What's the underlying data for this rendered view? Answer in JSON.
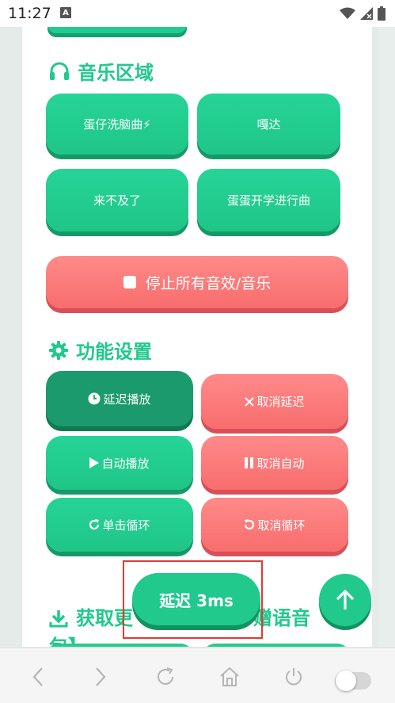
{
  "status": {
    "time": "11:27",
    "notif_letter": "A"
  },
  "music": {
    "title": "音乐区域",
    "buttons": [
      "蛋仔洗脑曲⚡",
      "嘎达",
      "来不及了",
      "蛋蛋开学进行曲"
    ],
    "stop_label": "停止所有音效/音乐"
  },
  "settings": {
    "title": "功能设置",
    "delay_play": "延迟播放",
    "cancel_delay": "取消延迟",
    "auto_play": "自动播放",
    "cancel_auto": "取消自动",
    "single_loop": "单击循环",
    "cancel_loop": "取消循环"
  },
  "download": {
    "title_line1": "获取更",
    "title_line1_end": "赠语音",
    "title_line2": "包】"
  },
  "toast": {
    "text": "延迟 3ms"
  },
  "colors": {
    "green": "#21c98c",
    "red": "#f86d6d",
    "dark_green": "#1b9a6d",
    "highlight": "#e53935"
  },
  "icons": {
    "headphones": "headphones-icon",
    "gear": "gear-icon",
    "download": "download-icon",
    "clock": "clock-icon",
    "close": "close-icon",
    "play": "play-icon",
    "pause": "pause-icon",
    "redo": "redo-icon",
    "undo": "undo-icon",
    "stop": "stop-icon",
    "arrow_up": "arrow-up-icon"
  }
}
